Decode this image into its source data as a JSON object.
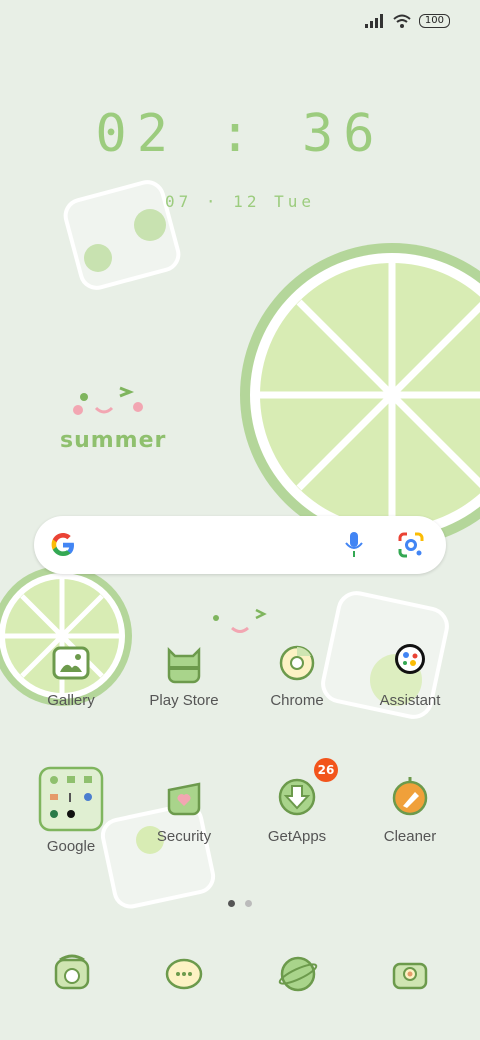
{
  "status": {
    "battery": "100"
  },
  "lockscreen": {
    "time": "02 : 36",
    "date": "07 · 12 Tue",
    "caption": "summer"
  },
  "search": {
    "engine": "Google"
  },
  "apps_row1": [
    {
      "label": "Gallery"
    },
    {
      "label": "Play Store"
    },
    {
      "label": "Chrome"
    },
    {
      "label": "Assistant"
    }
  ],
  "apps_row2": [
    {
      "label": "Google"
    },
    {
      "label": "Security"
    },
    {
      "label": "GetApps",
      "badge": "26"
    },
    {
      "label": "Cleaner"
    }
  ],
  "dock": [
    {
      "icon": "phone-icon"
    },
    {
      "icon": "messages-icon"
    },
    {
      "icon": "browser-icon"
    },
    {
      "icon": "camera-icon"
    }
  ],
  "colors": {
    "accent": "#9ccc7e",
    "lime": "#d8ecb4",
    "badge": "#f2541b"
  }
}
